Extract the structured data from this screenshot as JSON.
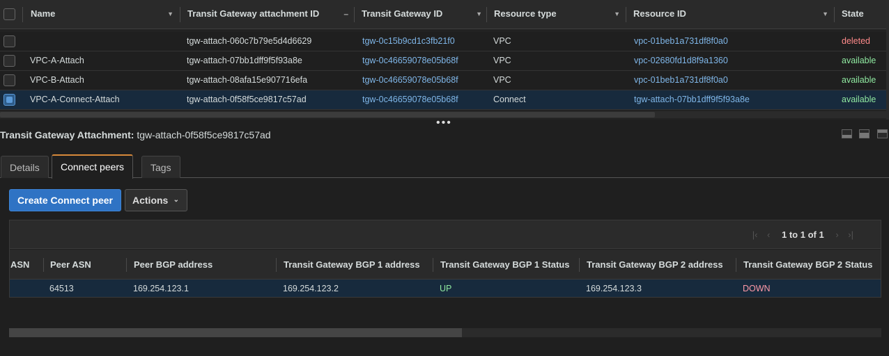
{
  "attachments_table": {
    "columns": [
      "Name",
      "Transit Gateway attachment ID",
      "Transit Gateway ID",
      "Resource type",
      "Resource ID",
      "State"
    ],
    "rows": [
      {
        "name": "",
        "attachment_id": "tgw-attach-060c7b79e5d4d6629",
        "tgw_id": "tgw-0c15b9cd1c3fb21f0",
        "resource_type": "VPC",
        "resource_id": "vpc-01beb1a731df8f0a0",
        "state": "deleted",
        "selected": false
      },
      {
        "name": "VPC-A-Attach",
        "attachment_id": "tgw-attach-07bb1dff9f5f93a8e",
        "tgw_id": "tgw-0c46659078e05b68f",
        "resource_type": "VPC",
        "resource_id": "vpc-02680fd1d8f9a1360",
        "state": "available",
        "selected": false
      },
      {
        "name": "VPC-B-Attach",
        "attachment_id": "tgw-attach-08afa15e907716efa",
        "tgw_id": "tgw-0c46659078e05b68f",
        "resource_type": "VPC",
        "resource_id": "vpc-01beb1a731df8f0a0",
        "state": "available",
        "selected": false
      },
      {
        "name": "VPC-A-Connect-Attach",
        "attachment_id": "tgw-attach-0f58f5ce9817c57ad",
        "tgw_id": "tgw-0c46659078e05b68f",
        "resource_type": "Connect",
        "resource_id": "tgw-attach-07bb1dff9f5f93a8e",
        "state": "available",
        "selected": true
      }
    ]
  },
  "detail": {
    "title_label": "Transit Gateway Attachment:",
    "title_value": "tgw-attach-0f58f5ce9817c57ad",
    "tabs": [
      "Details",
      "Connect peers",
      "Tags"
    ],
    "active_tab": "Connect peers",
    "create_button": "Create Connect peer",
    "actions_button": "Actions",
    "pagination": "1 to 1 of 1",
    "peer_columns": [
      "ASN",
      "Peer ASN",
      "Peer BGP address",
      "Transit Gateway BGP 1 address",
      "Transit Gateway BGP 1 Status",
      "Transit Gateway BGP 2 address",
      "Transit Gateway BGP 2 Status"
    ],
    "peer_rows": [
      {
        "asn": "",
        "peer_asn": "64513",
        "peer_bgp_address": "169.254.123.1",
        "tgw_bgp1_address": "169.254.123.2",
        "tgw_bgp1_status": "UP",
        "tgw_bgp2_address": "169.254.123.3",
        "tgw_bgp2_status": "DOWN"
      }
    ]
  },
  "colors": {
    "link": "#7fb6e8",
    "available": "#8fe8a0",
    "deleted": "#ff8a8a",
    "down": "#ff9aa8",
    "primary_button": "#2f73c4",
    "active_tab_accent": "#d8893a",
    "selected_row": "#172a3d"
  }
}
